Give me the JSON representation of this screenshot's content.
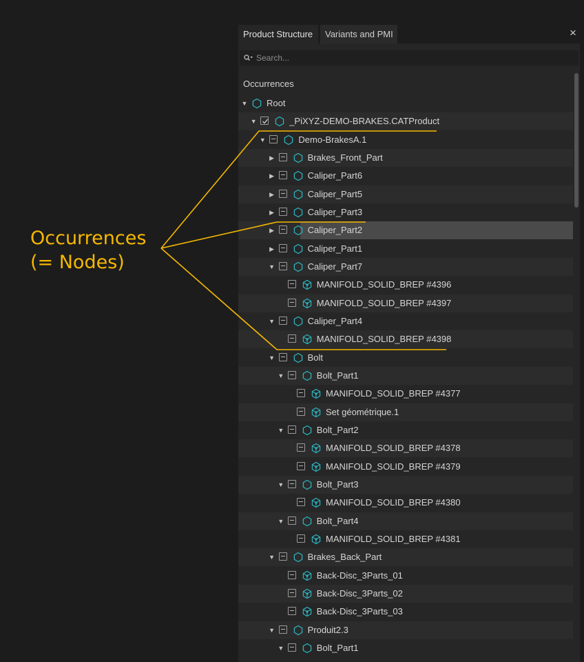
{
  "annotation": {
    "line1": "Occurrences",
    "line2": "(= Nodes)",
    "color": "#f5b800"
  },
  "tabs": [
    {
      "label": "Product Structure",
      "active": true
    },
    {
      "label": "Variants and PMI",
      "active": false
    }
  ],
  "close_label": "×",
  "search": {
    "placeholder": "Search..."
  },
  "tree_header": "Occurrences",
  "colors": {
    "accent_icon": "#2bb3bf",
    "panel_bg": "#262626",
    "selection_bg": "#4a4a4a"
  },
  "tree": [
    {
      "label": "Root",
      "level": 0,
      "expand": "open",
      "check": "none",
      "icon": "hexagon-icon"
    },
    {
      "label": "_PiXYZ-DEMO-BRAKES.CATProduct",
      "level": 1,
      "expand": "open",
      "check": "checked",
      "icon": "hexagon-icon"
    },
    {
      "label": "Demo-BrakesA.1",
      "level": 2,
      "expand": "open",
      "check": "partial",
      "icon": "hexagon-icon"
    },
    {
      "label": "Brakes_Front_Part",
      "level": 3,
      "expand": "closed",
      "check": "partial",
      "icon": "hexagon-icon"
    },
    {
      "label": "Caliper_Part6",
      "level": 3,
      "expand": "closed",
      "check": "partial",
      "icon": "hexagon-icon"
    },
    {
      "label": "Caliper_Part5",
      "level": 3,
      "expand": "closed",
      "check": "partial",
      "icon": "hexagon-icon"
    },
    {
      "label": "Caliper_Part3",
      "level": 3,
      "expand": "closed",
      "check": "partial",
      "icon": "hexagon-icon"
    },
    {
      "label": "Caliper_Part2",
      "level": 3,
      "expand": "closed",
      "check": "partial",
      "icon": "hexagon-icon",
      "selected": true
    },
    {
      "label": "Caliper_Part1",
      "level": 3,
      "expand": "closed",
      "check": "partial",
      "icon": "hexagon-icon"
    },
    {
      "label": "Caliper_Part7",
      "level": 3,
      "expand": "open",
      "check": "partial",
      "icon": "hexagon-icon"
    },
    {
      "label": "MANIFOLD_SOLID_BREP #4396",
      "level": 4,
      "expand": "none",
      "check": "partial",
      "icon": "mesh-icon"
    },
    {
      "label": "MANIFOLD_SOLID_BREP #4397",
      "level": 4,
      "expand": "none",
      "check": "partial",
      "icon": "mesh-icon"
    },
    {
      "label": "Caliper_Part4",
      "level": 3,
      "expand": "open",
      "check": "partial",
      "icon": "hexagon-icon"
    },
    {
      "label": "MANIFOLD_SOLID_BREP #4398",
      "level": 4,
      "expand": "none",
      "check": "partial",
      "icon": "mesh-icon"
    },
    {
      "label": "Bolt",
      "level": 3,
      "expand": "open",
      "check": "partial",
      "icon": "hexagon-icon"
    },
    {
      "label": "Bolt_Part1",
      "level": 4,
      "expand": "open",
      "check": "partial",
      "icon": "hexagon-icon"
    },
    {
      "label": "MANIFOLD_SOLID_BREP #4377",
      "level": 5,
      "expand": "none",
      "check": "partial",
      "icon": "mesh-icon"
    },
    {
      "label": "Set géométrique.1",
      "level": 5,
      "expand": "none",
      "check": "partial",
      "icon": "mesh-icon"
    },
    {
      "label": "Bolt_Part2",
      "level": 4,
      "expand": "open",
      "check": "partial",
      "icon": "hexagon-icon"
    },
    {
      "label": "MANIFOLD_SOLID_BREP #4378",
      "level": 5,
      "expand": "none",
      "check": "partial",
      "icon": "mesh-icon"
    },
    {
      "label": "MANIFOLD_SOLID_BREP #4379",
      "level": 5,
      "expand": "none",
      "check": "partial",
      "icon": "mesh-icon"
    },
    {
      "label": "Bolt_Part3",
      "level": 4,
      "expand": "open",
      "check": "partial",
      "icon": "hexagon-icon"
    },
    {
      "label": "MANIFOLD_SOLID_BREP #4380",
      "level": 5,
      "expand": "none",
      "check": "partial",
      "icon": "mesh-icon"
    },
    {
      "label": "Bolt_Part4",
      "level": 4,
      "expand": "open",
      "check": "partial",
      "icon": "hexagon-icon"
    },
    {
      "label": "MANIFOLD_SOLID_BREP #4381",
      "level": 5,
      "expand": "none",
      "check": "partial",
      "icon": "mesh-icon"
    },
    {
      "label": "Brakes_Back_Part",
      "level": 3,
      "expand": "open",
      "check": "partial",
      "icon": "hexagon-icon"
    },
    {
      "label": "Back-Disc_3Parts_01",
      "level": 4,
      "expand": "none",
      "check": "partial",
      "icon": "mesh-icon"
    },
    {
      "label": "Back-Disc_3Parts_02",
      "level": 4,
      "expand": "none",
      "check": "partial",
      "icon": "mesh-icon"
    },
    {
      "label": "Back-Disc_3Parts_03",
      "level": 4,
      "expand": "none",
      "check": "partial",
      "icon": "mesh-icon"
    },
    {
      "label": "Produit2.3",
      "level": 3,
      "expand": "open",
      "check": "partial",
      "icon": "hexagon-icon"
    },
    {
      "label": "Bolt_Part1",
      "level": 4,
      "expand": "open",
      "check": "partial",
      "icon": "hexagon-icon"
    }
  ]
}
